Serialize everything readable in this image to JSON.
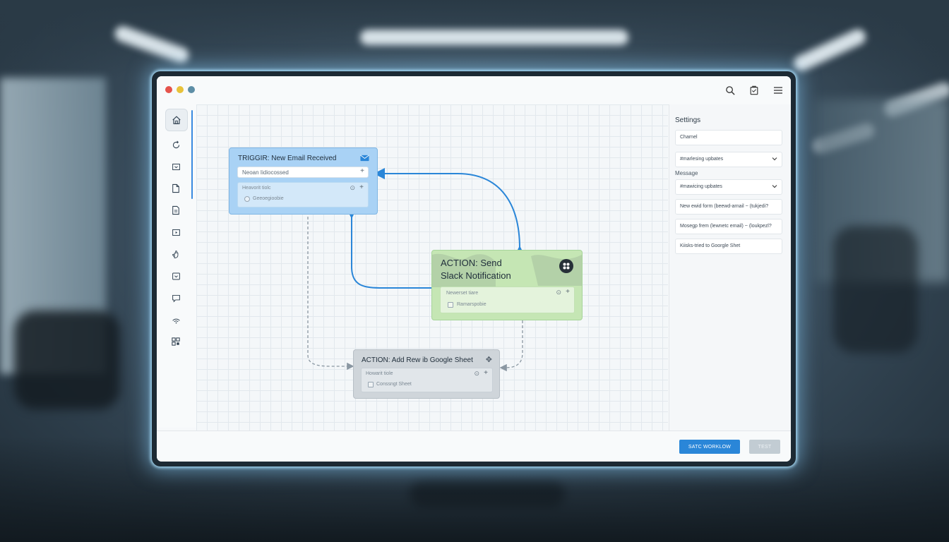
{
  "window": {
    "traffic_lights": [
      "#e5534b",
      "#e8c23a",
      "#5d8ea6"
    ],
    "toolbar_icons": [
      "search-icon",
      "clipboard-icon",
      "menu-icon"
    ]
  },
  "sidebar": {
    "items": [
      {
        "icon": "home-icon"
      },
      {
        "icon": "refresh-icon"
      },
      {
        "icon": "inbox-icon"
      },
      {
        "icon": "document-icon"
      },
      {
        "icon": "file-text-icon"
      },
      {
        "icon": "play-box-icon"
      },
      {
        "icon": "hand-icon"
      },
      {
        "icon": "download-box-icon"
      },
      {
        "icon": "chat-icon"
      },
      {
        "icon": "signal-icon"
      },
      {
        "icon": "grid-icon"
      }
    ]
  },
  "nodes": {
    "trigger": {
      "title": "TRIGGIR: New Email Received",
      "field_value": "Neoan Iidiocossed",
      "sub_label": "Heavorit tiolc",
      "sub_item": "Geeoegioobie",
      "color": "#a9d2f5"
    },
    "slack": {
      "title_line1": "ACTION: Send",
      "title_line2": "Slack Notification",
      "sub_label": "Newerset tiare",
      "sub_item": "Ramarspobie",
      "color": "#c5e6b4"
    },
    "sheet": {
      "title": "ACTION: Add Rew ib Google Sheet",
      "sub_label": "Howarit tiole",
      "sub_item": "Conssngt Sheet",
      "color": "#cfd5da"
    }
  },
  "settings": {
    "title": "Settings",
    "channel_label": "Charnel",
    "channel_value": "#marlesing upbates",
    "message_label": "Message",
    "message_value": "#mawicing upbates",
    "lines": [
      "New ewid form (beewd-arnail ~ (tukjedi?",
      "Mosegp frem (lewnetc email) ~ (loukpezl?",
      "Kiisks-tried to Goorgle Shet"
    ]
  },
  "footer": {
    "save_label": "SATC WORKLOW",
    "test_label": "TEST"
  }
}
